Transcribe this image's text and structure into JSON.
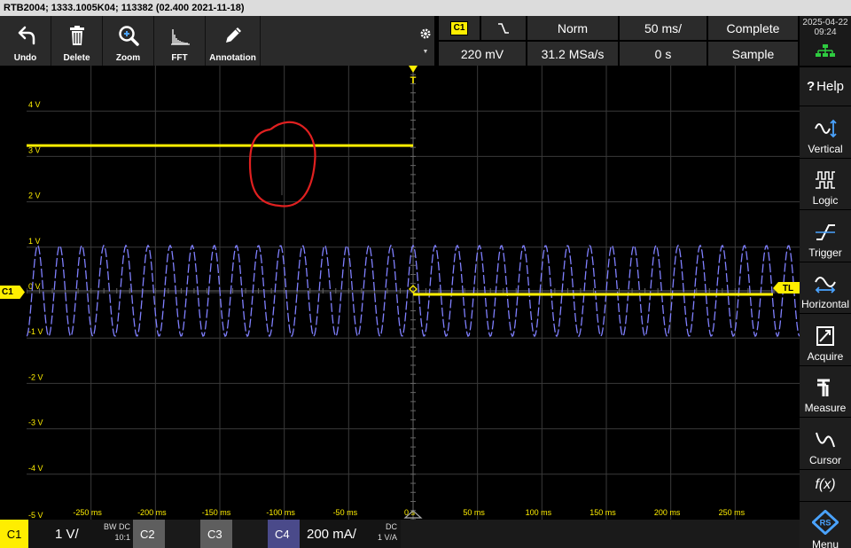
{
  "title_bar": "RTB2004; 1333.1005K04; 113382 (02.400 2021-11-18)",
  "toolbar": [
    {
      "label": "Undo",
      "icon": "undo-icon"
    },
    {
      "label": "Delete",
      "icon": "trash-icon"
    },
    {
      "label": "Zoom",
      "icon": "zoom-icon"
    },
    {
      "label": "FFT",
      "icon": "fft-icon"
    },
    {
      "label": "Annotation",
      "icon": "pencil-icon"
    }
  ],
  "settings": {
    "trigger_channel": "C1",
    "trigger_level": "220 mV",
    "trigger_mode": "Norm",
    "sample_rate": "31.2 MSa/s",
    "timebase": "50 ms/",
    "time_offset": "0 s",
    "acq_status": "Complete",
    "acq_mode": "Sample"
  },
  "datetime": {
    "date": "2025-04-22",
    "time": "09:24"
  },
  "sidebar": [
    {
      "label": "Vertical",
      "icon": "vertical-icon"
    },
    {
      "label": "Logic",
      "icon": "logic-icon"
    },
    {
      "label": "Trigger",
      "icon": "trigger-icon"
    },
    {
      "label": "Horizontal",
      "icon": "horizontal-icon"
    },
    {
      "label": "Acquire",
      "icon": "acquire-icon"
    },
    {
      "label": "Measure",
      "icon": "measure-icon"
    },
    {
      "label": "Cursor",
      "icon": "cursor-icon"
    }
  ],
  "help_label": "Help",
  "fx_label": "f(x)",
  "menu_label": "Menu",
  "y_labels": [
    "4 V",
    "3 V",
    "2 V",
    "1 V",
    "0 V",
    "-1 V",
    "-2 V",
    "-3 V",
    "-4 V",
    "-5 V"
  ],
  "x_labels": [
    "-250 ms",
    "-200 ms",
    "-150 ms",
    "-100 ms",
    "-50 ms",
    "0 s",
    "50 ms",
    "100 ms",
    "150 ms",
    "200 ms",
    "250 ms"
  ],
  "trigger_marker": "T",
  "trigger_level_marker": "TL",
  "channel_marker": "C1",
  "bottom": {
    "c1": {
      "label": "C1",
      "scale": "1 V/",
      "bw": "BW",
      "coupling": "DC",
      "probe": "10:1"
    },
    "c2": {
      "label": "C2"
    },
    "c3": {
      "label": "C3"
    },
    "c4": {
      "label": "C4",
      "scale": "200 mA/",
      "coupling": "DC",
      "probe": "1 V/A"
    }
  },
  "colors": {
    "ch1": "#ffee00",
    "ch4": "#8080ff",
    "annotation": "#e02020",
    "grid": "#3a3a3a",
    "menu": "#1a5fb4"
  },
  "waveforms": {
    "ch1_high_level_v": 3.2,
    "ch1_low_level_v": 0.0,
    "ch1_step_time_ms": 0,
    "ch4_amplitude_div": 1.0,
    "ch4_cycles_per_10_div": 35
  }
}
